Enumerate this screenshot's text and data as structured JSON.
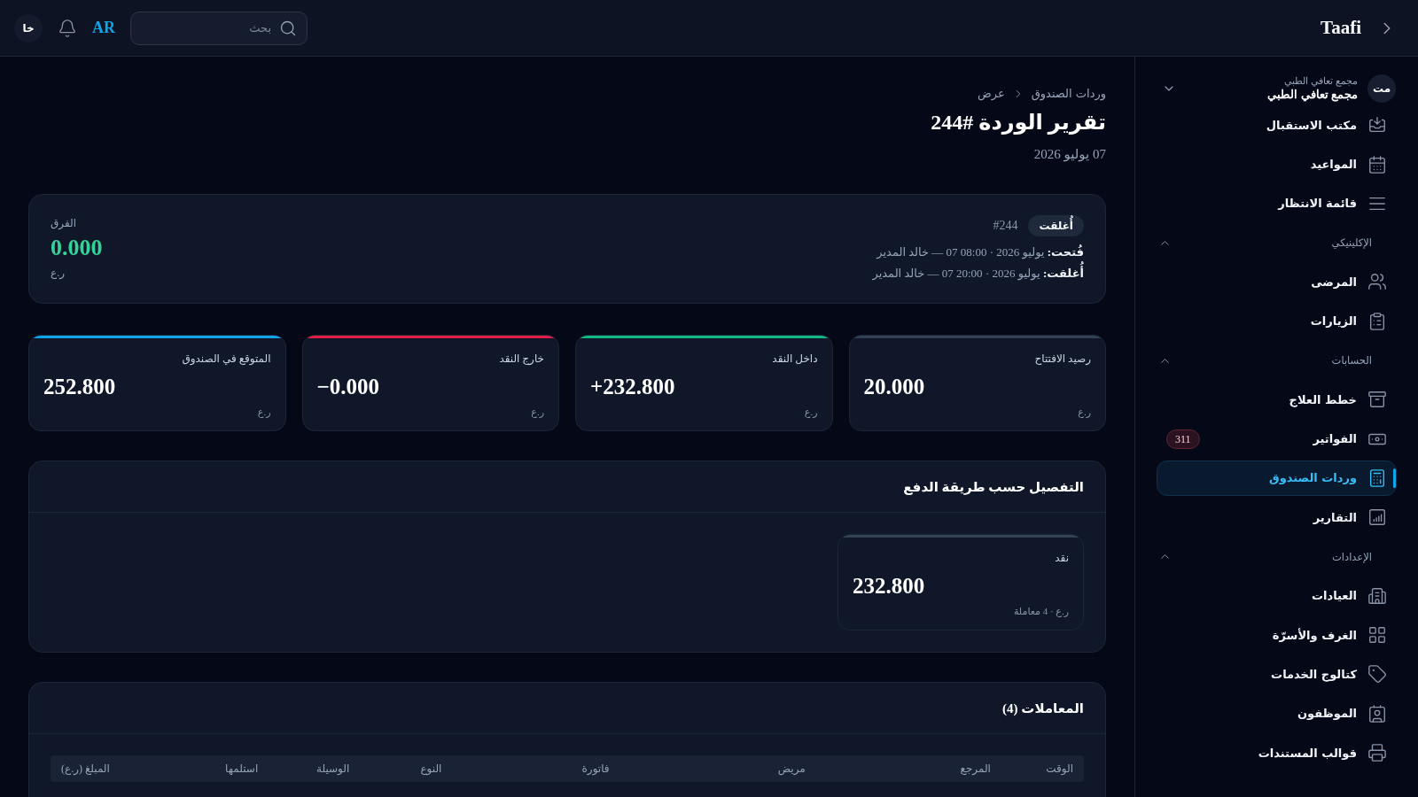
{
  "top_bar": {
    "brand": "Taafi",
    "search": {
      "placeholder": "بحث"
    },
    "language": "AR",
    "user_initials": "خا"
  },
  "sidebar": {
    "organization": {
      "initials": "مت",
      "caption": "مجمع تعافي الطبي",
      "name": "مجمع تعافي الطبي"
    },
    "items": [
      {
        "label": "مكتب الاستقبال",
        "selected": false
      },
      {
        "label": "المواعيد",
        "selected": false
      },
      {
        "label": "قائمة الانتظار",
        "selected": false
      }
    ],
    "sections": [
      {
        "title": "الإكلينيكي",
        "expanded": true,
        "items": [
          {
            "label": "المرضى",
            "selected": false
          },
          {
            "label": "الزيارات",
            "selected": false
          }
        ]
      },
      {
        "title": "الحسابات",
        "expanded": true,
        "items": [
          {
            "label": "خطط العلاج",
            "selected": false
          },
          {
            "label": "الفواتير",
            "selected": false,
            "badge": "311"
          },
          {
            "label": "وردات الصندوق",
            "selected": true
          },
          {
            "label": "التقارير",
            "selected": false
          }
        ]
      },
      {
        "title": "الإعدادات",
        "expanded": true,
        "items": [
          {
            "label": "العيادات",
            "selected": false
          },
          {
            "label": "الغرف والأسرّة",
            "selected": false
          },
          {
            "label": "كتالوج الخدمات",
            "selected": false
          },
          {
            "label": "الموظفون",
            "selected": false
          },
          {
            "label": "قوالب المستندات",
            "selected": false
          }
        ]
      }
    ]
  },
  "breadcrumb": [
    "وردات الصندوق",
    "عرض"
  ],
  "page": {
    "title": "تقرير الوردة #244",
    "date": "07 يوليو 2026"
  },
  "shift_summary": {
    "status": "أُغلقت",
    "number": "#244",
    "opened": "**فُتحت:** يوليو 2026 · 08:00 07 — خالد المدير",
    "closed": "**أُغلقت:** يوليو 2026 · 20:00 07 — خالد المدير",
    "difference": {
      "label": "الفرق",
      "value": "0.000",
      "unit": "ر.ع",
      "balanced": true
    }
  },
  "stats": [
    {
      "label": "رصيد الافتتاح",
      "value": "20.000",
      "unit": "ر.ع",
      "color": "#334155"
    },
    {
      "label": "داخل النقد",
      "value": "+232.800",
      "unit": "ر.ع",
      "color": "#10b981"
    },
    {
      "label": "خارج النقد",
      "value": "−0.000",
      "unit": "ر.ع",
      "color": "#e11d48"
    },
    {
      "label": "المتوقع في الصندوق",
      "value": "252.800",
      "unit": "ر.ع",
      "color": "#0ea5e9"
    }
  ],
  "payment_breakdown": {
    "title": "التفصيل حسب طريقة الدفع",
    "methods": [
      {
        "label": "نقد",
        "value": "232.800",
        "detail": "ر.ع · 4 معاملة"
      }
    ]
  },
  "transactions": {
    "title": "المعاملات (4)",
    "columns": [
      {
        "label": "الوقت",
        "kind": "text"
      },
      {
        "label": "المرجع",
        "kind": "text"
      },
      {
        "label": "مريض",
        "kind": "text"
      },
      {
        "label": "فاتورة",
        "kind": "text"
      },
      {
        "label": "النوع",
        "kind": "text"
      },
      {
        "label": "الوسيلة",
        "kind": "text"
      },
      {
        "label": "استلمها",
        "kind": "text"
      },
      {
        "label": "المبلغ (ر.ع)",
        "kind": "amount"
      }
    ]
  }
}
